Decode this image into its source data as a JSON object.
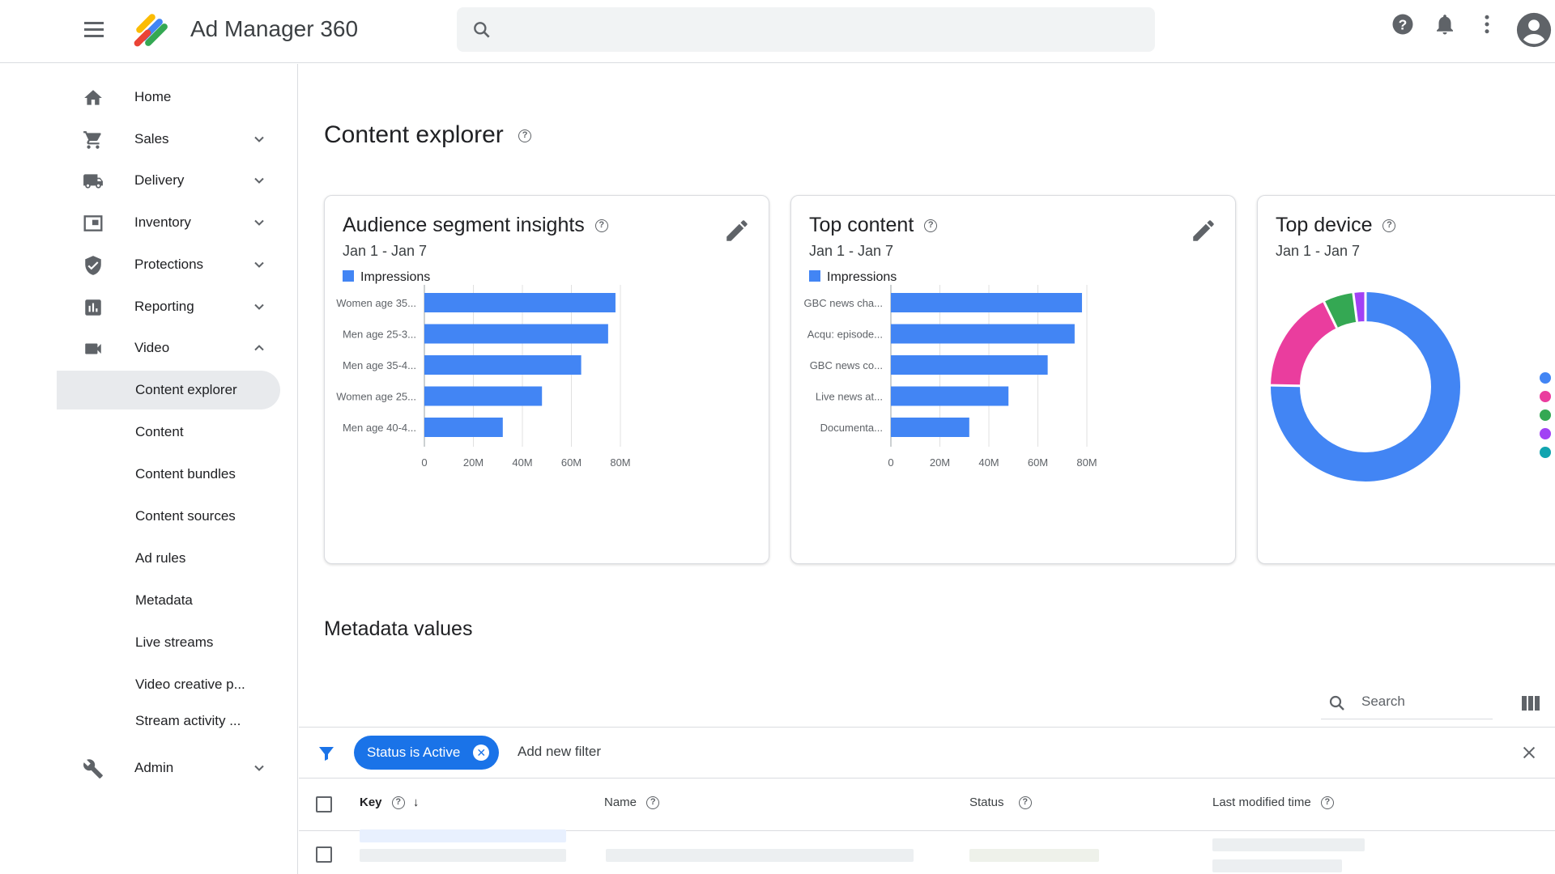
{
  "app": {
    "title": "Ad Manager 360"
  },
  "search": {
    "placeholder": ""
  },
  "sidebar": {
    "items": [
      {
        "label": "Home",
        "icon": "home-icon"
      },
      {
        "label": "Sales",
        "icon": "cart-icon",
        "expandable": true
      },
      {
        "label": "Delivery",
        "icon": "truck-icon",
        "expandable": true
      },
      {
        "label": "Inventory",
        "icon": "inventory-icon",
        "expandable": true
      },
      {
        "label": "Protections",
        "icon": "shield-icon",
        "expandable": true
      },
      {
        "label": "Reporting",
        "icon": "bar-chart-icon",
        "expandable": true
      },
      {
        "label": "Video",
        "icon": "video-icon",
        "expanded": true
      }
    ],
    "video_subitems": [
      {
        "label": "Content explorer",
        "active": true
      },
      {
        "label": "Content"
      },
      {
        "label": "Content bundles"
      },
      {
        "label": "Content sources"
      },
      {
        "label": "Ad rules"
      },
      {
        "label": "Metadata"
      },
      {
        "label": "Live streams"
      },
      {
        "label": "Video creative p..."
      },
      {
        "label": "Stream activity ..."
      }
    ],
    "admin": {
      "label": "Admin",
      "icon": "wrench-icon"
    }
  },
  "page": {
    "title": "Content explorer"
  },
  "cards": {
    "audience": {
      "title": "Audience segment insights",
      "date_range": "Jan 1 - Jan 7",
      "legend": "Impressions"
    },
    "top_content": {
      "title": "Top content",
      "date_range": "Jan 1 - Jan 7",
      "legend": "Impressions"
    },
    "top_device": {
      "title": "Top device",
      "date_range": "Jan 1 - Jan 7"
    }
  },
  "chart_data": [
    {
      "type": "bar",
      "orientation": "horizontal",
      "categories": [
        "Women age 35...",
        "Men age 25-3...",
        "Men age 35-4...",
        "Women age 25...",
        "Men age 40-4..."
      ],
      "series": [
        {
          "name": "Impressions",
          "values": [
            78,
            75,
            64,
            48,
            32
          ]
        }
      ],
      "ticks": [
        "0",
        "20M",
        "40M",
        "60M",
        "80M"
      ],
      "xlim": [
        0,
        80
      ],
      "color": "#4285f4"
    },
    {
      "type": "bar",
      "orientation": "horizontal",
      "categories": [
        "GBC news cha...",
        "Acqu: episode...",
        "GBC news co...",
        "Live news at...",
        "Documenta..."
      ],
      "series": [
        {
          "name": "Impressions",
          "values": [
            78,
            75,
            64,
            48,
            32
          ]
        }
      ],
      "ticks": [
        "0",
        "20M",
        "40M",
        "60M",
        "80M"
      ],
      "xlim": [
        0,
        80
      ],
      "color": "#4285f4"
    },
    {
      "type": "pie",
      "donut": true,
      "values": [
        73,
        17,
        5,
        2,
        0
      ],
      "colors": [
        "#4285f4",
        "#ea3d9e",
        "#34a853",
        "#a142f4",
        "#12a4af"
      ]
    }
  ],
  "metadata_section": {
    "title": "Metadata values",
    "search_label": "Search",
    "filter_chip": "Status is Active",
    "add_filter": "Add new filter",
    "columns": [
      "Key",
      "Name",
      "Status",
      "Last modified time"
    ]
  }
}
